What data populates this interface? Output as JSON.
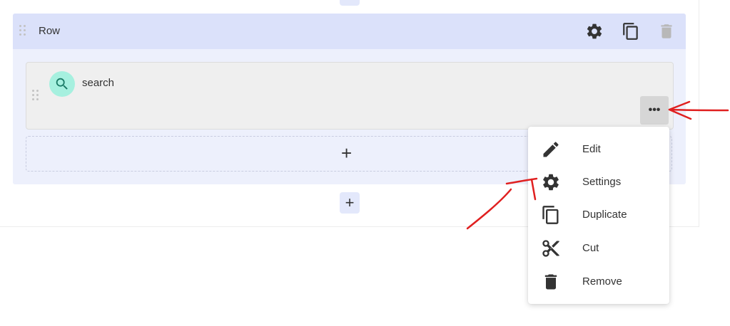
{
  "row": {
    "title": "Row",
    "actions": [
      "settings-icon",
      "duplicate-icon",
      "delete-icon"
    ]
  },
  "column": {
    "widget_label": "search",
    "widget_icon": "search-icon",
    "more_label": "•••"
  },
  "add_column": {
    "label": "+"
  },
  "add_row": {
    "label": "+"
  },
  "menu": {
    "items": [
      {
        "label": "Edit",
        "icon": "pencil-icon"
      },
      {
        "label": "Settings",
        "icon": "gear-icon"
      },
      {
        "label": "Duplicate",
        "icon": "duplicate-icon"
      },
      {
        "label": "Cut",
        "icon": "scissors-icon"
      },
      {
        "label": "Remove",
        "icon": "trash-icon"
      }
    ]
  },
  "colors": {
    "row_header_bg": "#dbe1fa",
    "row_body_bg": "#edf0fc",
    "search_avatar_bg": "#a6f0df",
    "annotation_arrow": "#e02020"
  }
}
